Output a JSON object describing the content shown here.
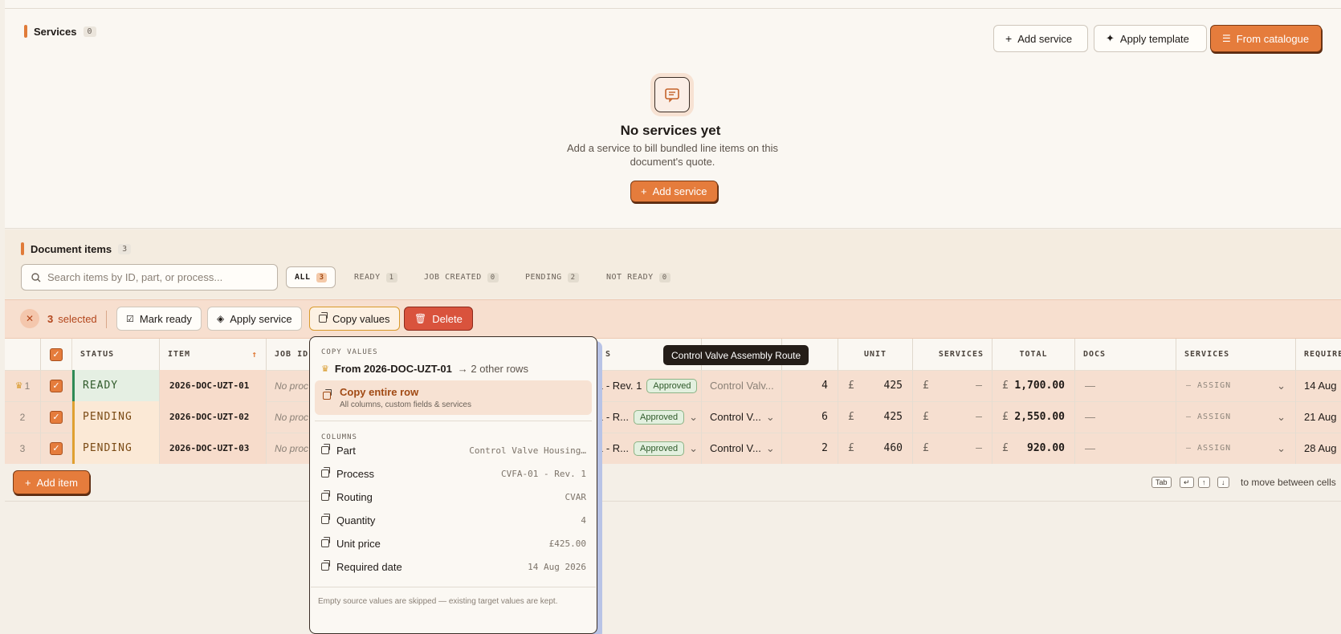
{
  "services": {
    "title": "Services",
    "count": "0",
    "add_label": "Add service",
    "template_label": "Apply template",
    "catalogue_label": "From catalogue",
    "empty_title": "No services yet",
    "empty_sub": "Add a service to bill bundled line items on this document's quote.",
    "empty_cta": "Add service"
  },
  "items": {
    "title": "Document items",
    "count": "3",
    "search_placeholder": "Search items by ID, part, or process...",
    "filters": [
      {
        "label": "ALL",
        "count": "3"
      },
      {
        "label": "READY",
        "count": "1"
      },
      {
        "label": "JOB CREATED",
        "count": "0"
      },
      {
        "label": "PENDING",
        "count": "2"
      },
      {
        "label": "NOT READY",
        "count": "0"
      }
    ]
  },
  "selection": {
    "count": "3",
    "selected_label": "selected",
    "mark_ready": "Mark ready",
    "apply_service": "Apply service",
    "copy_values": "Copy values",
    "delete": "Delete"
  },
  "table": {
    "headers": {
      "status": "STATUS",
      "item": "ITEM",
      "job": "JOB ID",
      "process_tail": "S",
      "unit": "UNIT",
      "services_amt": "SERVICES",
      "total": "TOTAL",
      "docs": "DOCS",
      "services": "SERVICES",
      "required": "REQUIRE"
    },
    "rows": [
      {
        "n": "1",
        "status": "READY",
        "item": "2026-DOC-UZT-01",
        "job": "No proc",
        "process": "1 - Rev. 1",
        "approval": "Approved",
        "routing": "Control Valv...",
        "qty": "4",
        "cur": "£",
        "unit": "425",
        "svc_cur": "£",
        "svc": "—",
        "tot_cur": "£",
        "total": "1,700.00",
        "docs": "—",
        "assign": "— ASSIGN",
        "required": "14 Aug"
      },
      {
        "n": "2",
        "status": "PENDING",
        "item": "2026-DOC-UZT-02",
        "job": "No proc",
        "process": "1 - R...",
        "approval": "Approved",
        "routing": "Control V...",
        "qty": "6",
        "cur": "£",
        "unit": "425",
        "svc_cur": "£",
        "svc": "—",
        "tot_cur": "£",
        "total": "2,550.00",
        "docs": "—",
        "assign": "— ASSIGN",
        "required": "21 Aug"
      },
      {
        "n": "3",
        "status": "PENDING",
        "item": "2026-DOC-UZT-03",
        "job": "No proc",
        "process": "1 - R...",
        "approval": "Approved",
        "routing": "Control V...",
        "qty": "2",
        "cur": "£",
        "unit": "460",
        "svc_cur": "£",
        "svc": "—",
        "tot_cur": "£",
        "total": "920.00",
        "docs": "—",
        "assign": "— ASSIGN",
        "required": "28 Aug"
      }
    ],
    "add_item": "Add item",
    "hint": "to move between cells",
    "keys": [
      "Tab",
      "↵",
      "↑",
      "↓"
    ]
  },
  "tooltip": "Control Valve Assembly Route",
  "copy_menu": {
    "label": "COPY VALUES",
    "from": "From 2026-DOC-UZT-01",
    "to": "→ 2 other rows",
    "entire_title": "Copy entire row",
    "entire_sub": "All columns, custom fields & services",
    "columns_label": "COLUMNS",
    "columns": [
      {
        "name": "Part",
        "value": "Control Valve Housing…"
      },
      {
        "name": "Process",
        "value": "CVFA-01 - Rev. 1"
      },
      {
        "name": "Routing",
        "value": "CVAR"
      },
      {
        "name": "Quantity",
        "value": "4"
      },
      {
        "name": "Unit price",
        "value": "£425.00"
      },
      {
        "name": "Required date",
        "value": "14 Aug 2026"
      }
    ],
    "footnote": "Empty source values are skipped — existing target values are kept."
  },
  "colors": {
    "accent": "#e57c3c",
    "danger": "#d9533d",
    "ready": "#2f8a55",
    "pending": "#e0a030"
  }
}
